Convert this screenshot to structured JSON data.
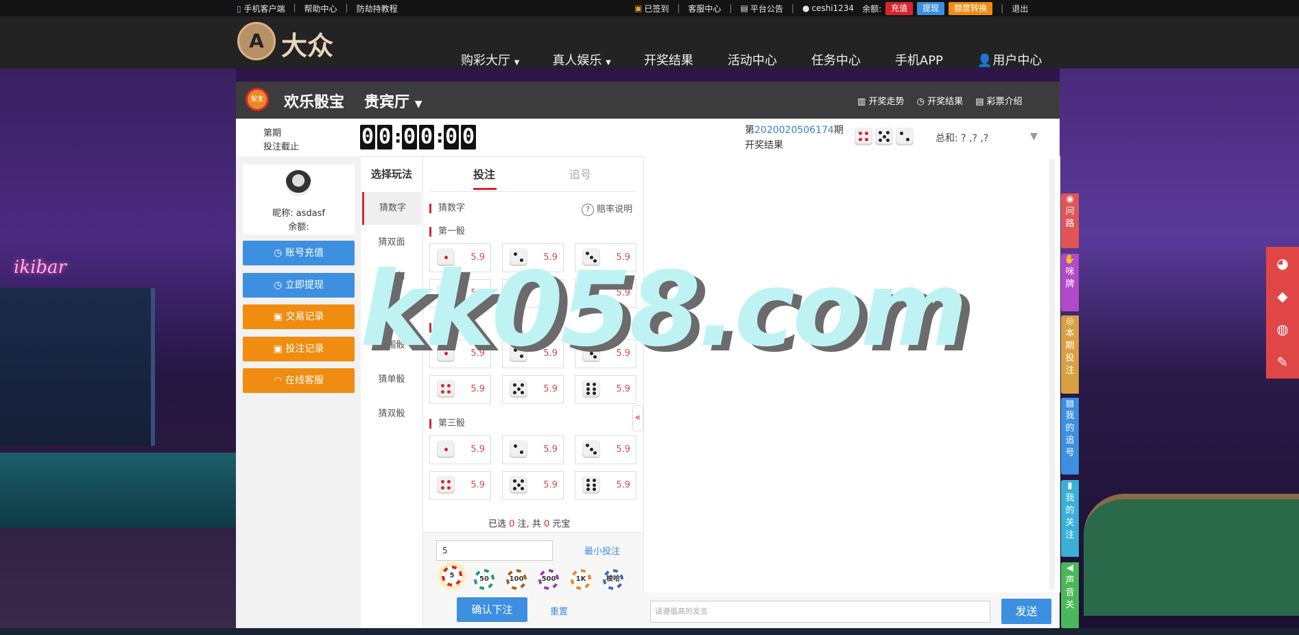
{
  "topbar": {
    "left": [
      "手机客户端",
      "帮助中心",
      "防劫持教程"
    ],
    "signed": "已签到",
    "service": "客服中心",
    "notice": "平台公告",
    "username": "ceshi1234",
    "balance_label": "余额:",
    "recharge": "充值",
    "withdraw": "提现",
    "transfer": "额度转换",
    "logout": "退出"
  },
  "brand": {
    "name": "大众"
  },
  "nav": {
    "items": [
      "购彩大厅",
      "真人娱乐",
      "开奖结果",
      "活动中心",
      "任务中心",
      "手机APP",
      "用户中心"
    ]
  },
  "game": {
    "title": "欢乐骰宝",
    "room": "贵宾厅",
    "icon_label": "骰宝",
    "links": [
      "开奖走势",
      "开奖结果",
      "彩票介绍"
    ],
    "period_label": "第期",
    "deadline_label": "投注截止",
    "timer": [
      "0",
      "0",
      "0",
      "0",
      "0",
      "0"
    ],
    "draw_prefix": "第",
    "draw_number": "2020020506174",
    "draw_suffix": "期",
    "draw_label": "开奖结果",
    "sum_label": "总和: ? ,? ,?"
  },
  "user": {
    "nickname_label": "昵称: asdasf",
    "balance_label": "余额:"
  },
  "sidebar": {
    "buttons": [
      "账号充值",
      "立即提现",
      "交易记录",
      "投注记录",
      "在线客服"
    ]
  },
  "play": {
    "header": "选择玩法",
    "items": [
      "猜数字",
      "猜双面",
      "猜总和",
      "猜对子",
      "猜围骰",
      "猜单骰",
      "猜双骰"
    ]
  },
  "bet": {
    "tabs": [
      "投注",
      "追号"
    ],
    "section_title": "猜数字",
    "odds_help": "赔率说明",
    "groups": [
      "第一骰",
      "第二骰",
      "第三骰"
    ],
    "odds": [
      "5.9",
      "5.9",
      "5.9",
      "5.9",
      "5.9",
      "5.9"
    ],
    "summary_a": "已选",
    "summary_count": "0",
    "summary_b": "注, 共",
    "summary_amount": "0",
    "summary_c": "元宝",
    "amount_value": "5",
    "min_bet": "最小投注",
    "chips": [
      "5",
      "50",
      "100",
      "500",
      "1K",
      "梭哈"
    ],
    "confirm": "确认下注",
    "reset": "重置"
  },
  "chat": {
    "placeholder": "请遵循高的发言",
    "send": "发送"
  },
  "right_tabs": [
    "问路",
    "咪牌",
    "本期投注",
    "我的追号",
    "我的关注",
    "声音关"
  ],
  "watermark": "kk058.com",
  "colors": {
    "accent_red": "#d8262d",
    "blue_btn": "#3d8fe0",
    "orange_btn": "#f08c10",
    "header_dark": "#3c3c3c"
  }
}
